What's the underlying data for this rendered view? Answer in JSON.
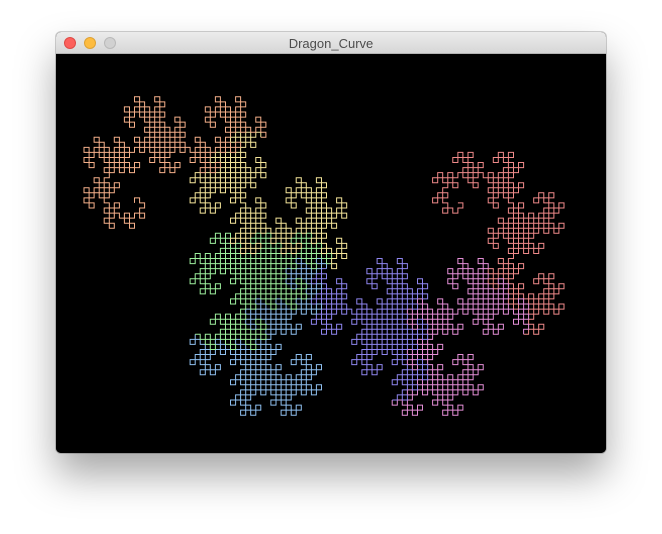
{
  "window": {
    "title": "Dragon_Curve",
    "controls": {
      "close": "close-button",
      "minimize": "minimize-button",
      "zoom": "zoom-button"
    }
  },
  "canvas": {
    "background": "#000000",
    "figure": "dragon-curve",
    "colors": [
      "#f08a8a",
      "#e58fd8",
      "#8f86f0",
      "#8fc0f0",
      "#9ef09e",
      "#f5e59a",
      "#f5b08a"
    ]
  }
}
